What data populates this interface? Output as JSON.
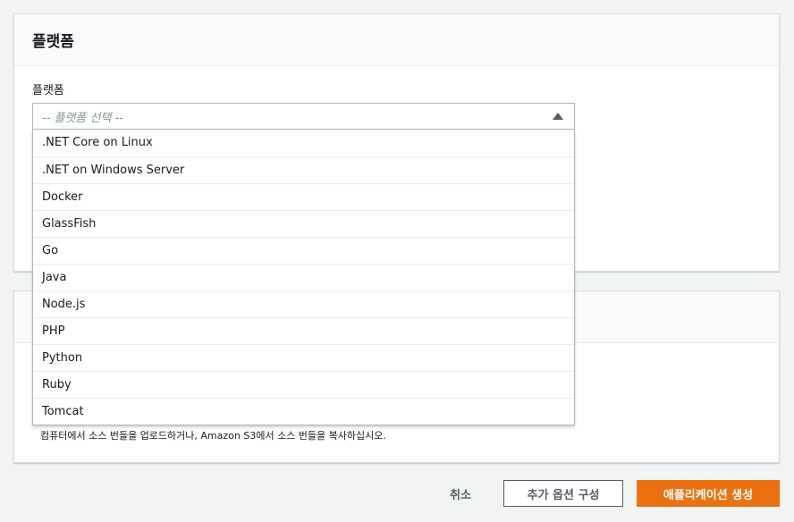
{
  "platform_panel": {
    "title": "플랫폼",
    "field_label": "플랫폼",
    "select_placeholder": "-- 플랫폼 선택 --"
  },
  "dropdown": {
    "options": [
      ".NET Core on Linux",
      ".NET on Windows Server",
      "Docker",
      "GlassFish",
      "Go",
      "Java",
      "Node.js",
      "PHP",
      "Python",
      "Ruby",
      "Tomcat"
    ]
  },
  "code_panel": {
    "help_text": "컴퓨터에서 소스 번들을 업로드하거나, Amazon S3에서 소스 번들을 복사하십시오."
  },
  "actions": {
    "cancel": "취소",
    "more_options": "추가 옵션 구성",
    "create": "애플리케이션 생성"
  },
  "colors": {
    "primary": "#ec7211",
    "background": "#f2f3f3"
  }
}
